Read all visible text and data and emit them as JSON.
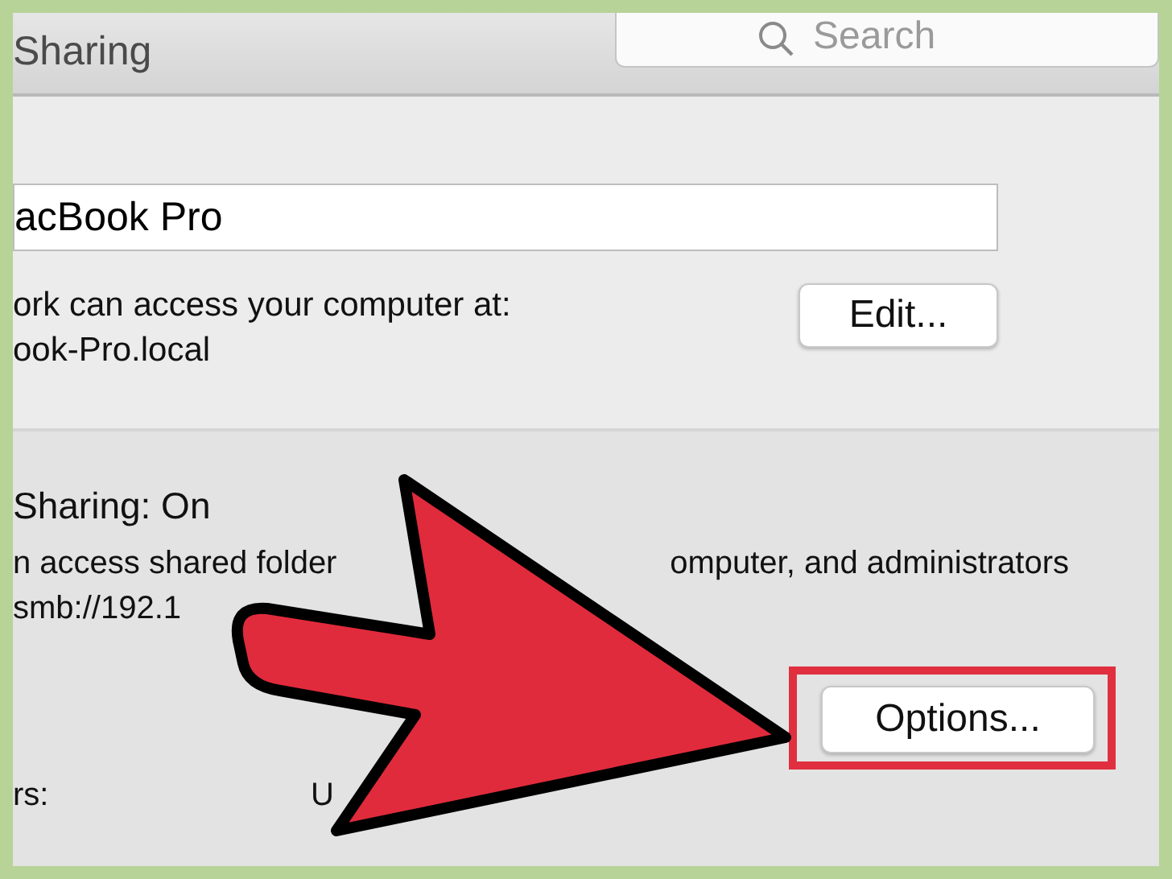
{
  "window": {
    "title": "Sharing"
  },
  "search": {
    "placeholder": "Search"
  },
  "computer_name": {
    "value": "acBook Pro"
  },
  "access_info": [
    "ork can access your computer at:",
    "ook-Pro.local"
  ],
  "edit_button": "Edit...",
  "file_sharing": {
    "status": "Sharing: On",
    "description_lines": [
      [
        "n access shared folder",
        "omputer, and administrators"
      ],
      [
        "smb://192.1"
      ]
    ],
    "options_button": "Options...",
    "highlighted": true
  },
  "users_label": "rs:",
  "column_2": "U",
  "annotations": [
    {
      "kind": "arrow"
    }
  ]
}
